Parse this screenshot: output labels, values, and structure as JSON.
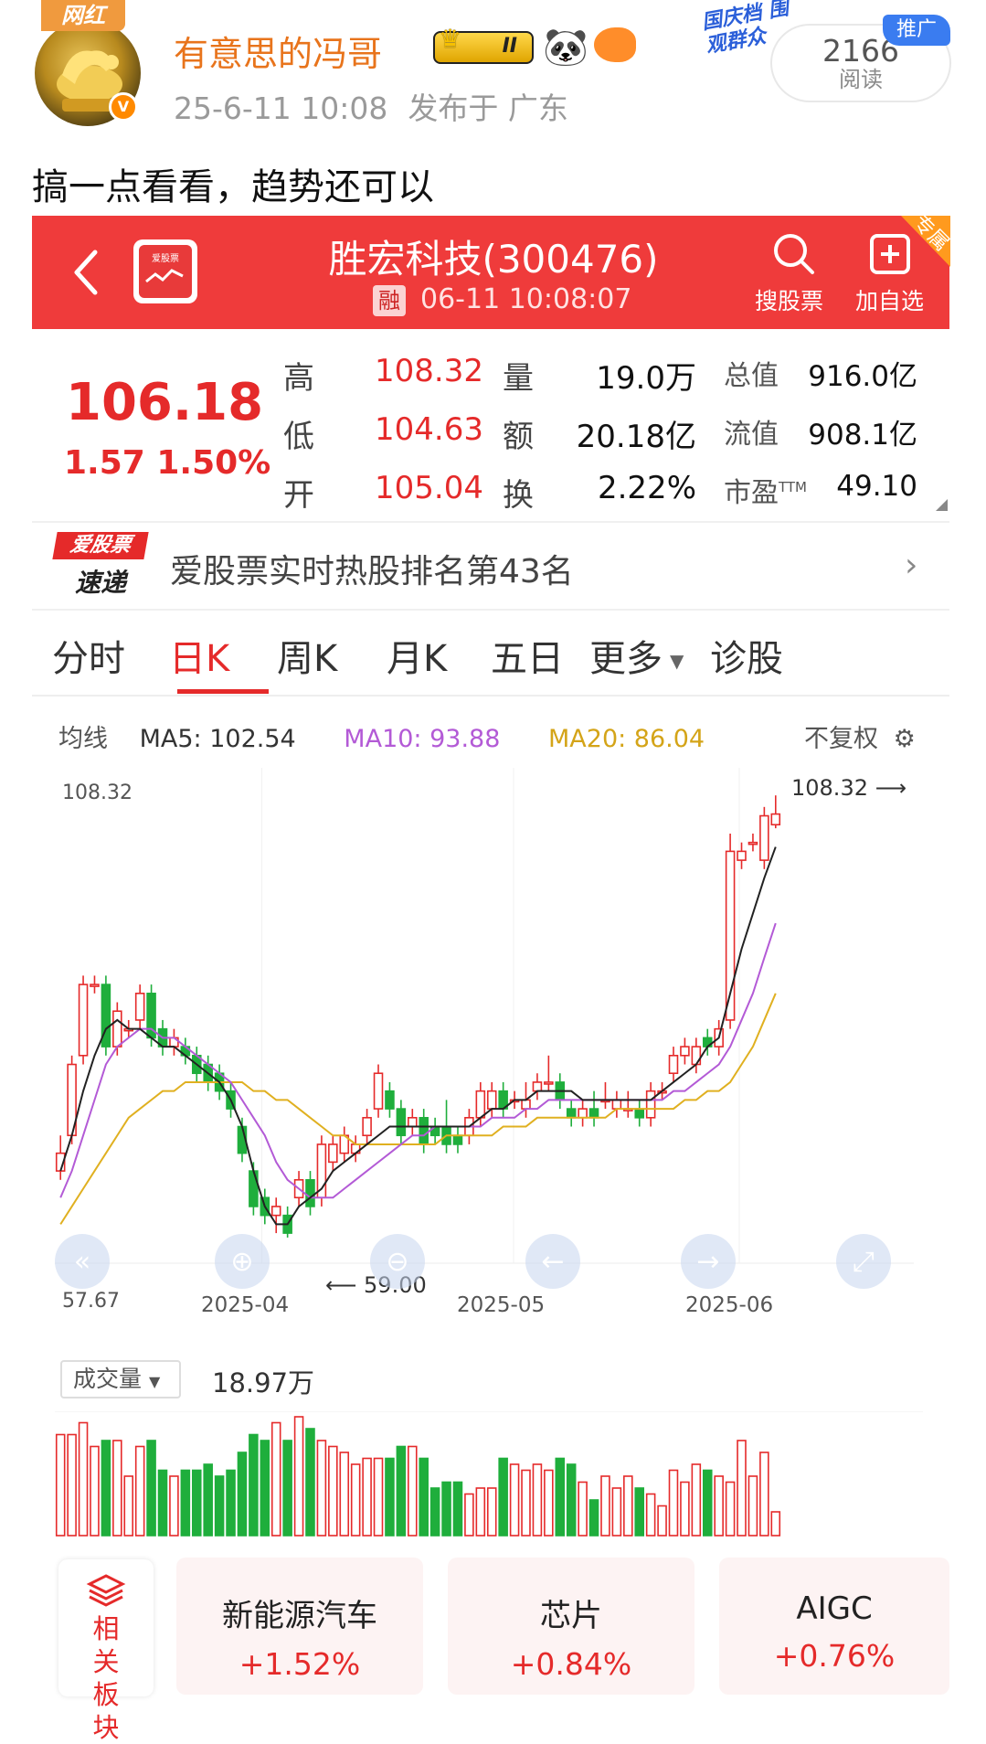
{
  "post": {
    "badge": "网红",
    "username": "有意思的冯哥",
    "vip_level": "II",
    "date": "25-6-11 10:08",
    "location": "发布于 广东",
    "read_count": "2166",
    "read_label": "阅读",
    "promo_text": "国庆档 围观群众",
    "promo_tag": "推广",
    "text": "搞一点看看，趋势还可以"
  },
  "app": {
    "logo_text": "爱股票",
    "stock_title": "胜宏科技(300476)",
    "rong": "融",
    "time": "06-11 10:08:07",
    "search_label": "搜股票",
    "add_label": "加自选",
    "corner_tag": "专属"
  },
  "quote": {
    "price": "106.18",
    "change": "1.57 1.50%",
    "rows": [
      {
        "l1": "高",
        "v1": "108.32",
        "l2": "量",
        "v2": "19.0万",
        "l3": "总值",
        "v3": "916.0亿"
      },
      {
        "l1": "低",
        "v1": "104.63",
        "l2": "额",
        "v2": "20.18亿",
        "l3": "流值",
        "v3": "908.1亿"
      },
      {
        "l1": "开",
        "v1": "105.04",
        "l2": "换",
        "v2": "2.22%",
        "l3": "市盈",
        "l3sup": "TTM",
        "v3": "49.10"
      }
    ]
  },
  "rank": {
    "logo_top": "爱股票",
    "logo_bottom": "速递",
    "text": "爱股票实时热股排名第43名"
  },
  "tabs": [
    "分时",
    "日K",
    "周K",
    "月K",
    "五日",
    "更多",
    "诊股"
  ],
  "ma": {
    "label": "均线",
    "ma5": "MA5: 102.54",
    "ma10": "MA10: 93.88",
    "ma20": "MA20: 86.04",
    "fuquan": "不复权"
  },
  "colors": {
    "up": "#e52a2a",
    "down": "#1fae3c",
    "ma5": "#222222",
    "ma10": "#b35ad6",
    "ma20": "#e0b020",
    "brand_red": "#ef3b3b"
  },
  "chart_data": {
    "type": "candlestick",
    "y_top_label": "108.32",
    "y_bottom_label": "57.67",
    "high_marker": "108.32",
    "low_marker": "59.00",
    "x_labels": [
      "2025-04",
      "2025-05",
      "2025-06"
    ],
    "ylim": [
      57.67,
      108.32
    ],
    "candles": [
      [
        66,
        68,
        65,
        70
      ],
      [
        70,
        78,
        69,
        79
      ],
      [
        79,
        87,
        78,
        88
      ],
      [
        87,
        87,
        86,
        88
      ],
      [
        87,
        80,
        79,
        88
      ],
      [
        80,
        84,
        79,
        85
      ],
      [
        82,
        82,
        81,
        83
      ],
      [
        83,
        86,
        82,
        87
      ],
      [
        86,
        81,
        80,
        87
      ],
      [
        82,
        80,
        79,
        83
      ],
      [
        80,
        81,
        79,
        82
      ],
      [
        80,
        79,
        78,
        81
      ],
      [
        79,
        77,
        76,
        80
      ],
      [
        78,
        76,
        75,
        79
      ],
      [
        77,
        75,
        74,
        78
      ],
      [
        75,
        73,
        72,
        76
      ],
      [
        71,
        68,
        67,
        72
      ],
      [
        66,
        62,
        61,
        67
      ],
      [
        63,
        61,
        60,
        64
      ],
      [
        61,
        62,
        59,
        63
      ],
      [
        61,
        59,
        58.5,
        62
      ],
      [
        63,
        65,
        62,
        66
      ],
      [
        65,
        62,
        61,
        66
      ],
      [
        63,
        69,
        62,
        70
      ],
      [
        67,
        69,
        66,
        70
      ],
      [
        68,
        70,
        67,
        71
      ],
      [
        68,
        69,
        67,
        70
      ],
      [
        70,
        72,
        69,
        73
      ],
      [
        73,
        77,
        72,
        78
      ],
      [
        75,
        73,
        72,
        76
      ],
      [
        73,
        70,
        69,
        74
      ],
      [
        71,
        72,
        70,
        73
      ],
      [
        72,
        69,
        68,
        73
      ],
      [
        71,
        70,
        69,
        72
      ],
      [
        71,
        69,
        68,
        74
      ],
      [
        70,
        69,
        68,
        71
      ],
      [
        70,
        72,
        69,
        73
      ],
      [
        72,
        75,
        71,
        76
      ],
      [
        73,
        75,
        72,
        76
      ],
      [
        75,
        73,
        72,
        76
      ],
      [
        74,
        74,
        73,
        75
      ],
      [
        73,
        74,
        72,
        76
      ],
      [
        75,
        76,
        74,
        77
      ],
      [
        76,
        76,
        75,
        79
      ],
      [
        76,
        74,
        73,
        77
      ],
      [
        73,
        72,
        71,
        74
      ],
      [
        72,
        73,
        71,
        74
      ],
      [
        73,
        72,
        71,
        75
      ],
      [
        74,
        74,
        73,
        76
      ],
      [
        73,
        74,
        72,
        75
      ],
      [
        73,
        73,
        72,
        75
      ],
      [
        73,
        72,
        71,
        74
      ],
      [
        72,
        75,
        71,
        76
      ],
      [
        75,
        75,
        74,
        76
      ],
      [
        77,
        79,
        76,
        80
      ],
      [
        79,
        80,
        78,
        81
      ],
      [
        78,
        80,
        77,
        81
      ],
      [
        81,
        80,
        79,
        82
      ],
      [
        80,
        82,
        79,
        83
      ],
      [
        83,
        102,
        82,
        104
      ],
      [
        101,
        102,
        100,
        103
      ],
      [
        103,
        103,
        102,
        104
      ],
      [
        101,
        106,
        100,
        107
      ],
      [
        105,
        106.2,
        104.6,
        108.3
      ]
    ],
    "ma5": [
      66,
      70,
      75,
      79,
      82,
      83,
      82,
      82,
      81,
      80,
      80,
      79,
      78,
      77,
      76,
      74,
      71,
      66,
      62,
      60,
      60,
      62,
      63,
      64,
      66,
      67,
      68,
      69,
      70,
      71,
      71,
      71,
      71,
      71,
      71,
      71,
      71,
      72,
      73,
      73,
      74,
      74,
      75,
      75,
      75,
      75,
      74,
      74,
      74,
      74,
      74,
      74,
      74,
      75,
      76,
      77,
      78,
      80,
      81,
      86,
      91,
      95,
      99,
      102.5
    ],
    "ma10": [
      63,
      66,
      70,
      74,
      78,
      80,
      81,
      82,
      82,
      81,
      81,
      80,
      79,
      78,
      77,
      76,
      74,
      72,
      70,
      67,
      65,
      64,
      63,
      63,
      63,
      64,
      65,
      66,
      67,
      68,
      69,
      70,
      70,
      71,
      71,
      71,
      71,
      71,
      72,
      72,
      72,
      73,
      73,
      74,
      74,
      74,
      74,
      74,
      74,
      74,
      74,
      74,
      74,
      74,
      75,
      75,
      76,
      77,
      78,
      80,
      83,
      86,
      90,
      93.9
    ],
    "ma20": [
      60,
      62,
      64,
      66,
      68,
      70,
      72,
      73,
      74,
      75,
      75,
      76,
      76,
      76,
      76,
      76,
      76,
      75,
      75,
      74,
      74,
      73,
      72,
      71,
      70,
      70,
      69,
      69,
      69,
      69,
      69,
      69,
      69,
      69,
      70,
      70,
      70,
      70,
      70,
      71,
      71,
      71,
      72,
      72,
      72,
      72,
      72,
      72,
      72,
      73,
      73,
      73,
      73,
      73,
      73,
      74,
      74,
      75,
      75,
      76,
      78,
      80,
      83,
      86.0
    ],
    "volumes": [
      0.85,
      0.85,
      0.95,
      0.75,
      0.8,
      0.8,
      0.5,
      0.75,
      0.8,
      0.55,
      0.5,
      0.55,
      0.55,
      0.6,
      0.5,
      0.55,
      0.7,
      0.85,
      0.8,
      0.95,
      0.8,
      1.0,
      0.9,
      0.8,
      0.75,
      0.7,
      0.6,
      0.65,
      0.65,
      0.65,
      0.75,
      0.75,
      0.65,
      0.4,
      0.45,
      0.45,
      0.35,
      0.4,
      0.4,
      0.65,
      0.6,
      0.55,
      0.6,
      0.55,
      0.65,
      0.6,
      0.45,
      0.3,
      0.5,
      0.4,
      0.5,
      0.4,
      0.35,
      0.25,
      0.55,
      0.45,
      0.6,
      0.55,
      0.5,
      0.45,
      0.8,
      0.5,
      0.7,
      0.2
    ],
    "volume_label": "成交量",
    "volume_value": "18.97万"
  },
  "sectors": {
    "side_label": "相关板块",
    "items": [
      {
        "name": "新能源汽车",
        "change": "+1.52%"
      },
      {
        "name": "芯片",
        "change": "+0.84%"
      },
      {
        "name": "AIGC",
        "change": "+0.76%"
      }
    ]
  }
}
